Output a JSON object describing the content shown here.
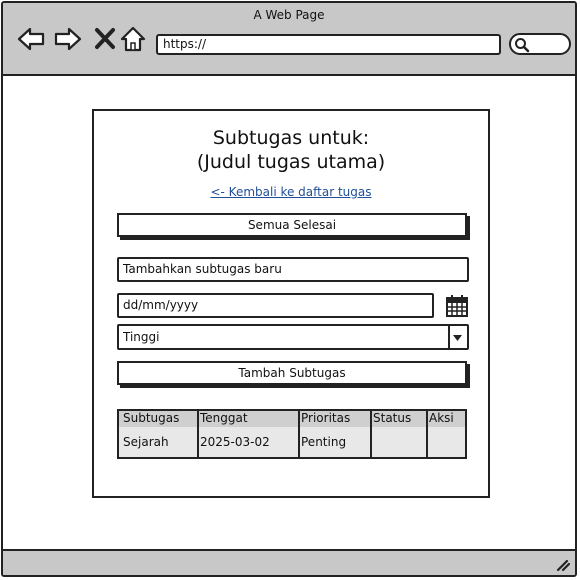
{
  "window": {
    "title": "A Web Page",
    "url": "https://"
  },
  "icons": {
    "back": "arrow-left-icon",
    "forward": "arrow-right-icon",
    "close": "close-icon",
    "home": "home-icon",
    "search": "search-icon",
    "calendar": "calendar-icon",
    "dropdown": "chevron-down-icon",
    "resize": "resize-grip-icon"
  },
  "page": {
    "title_line1": "Subtugas untuk:",
    "title_line2": "(Judul tugas utama)",
    "back_link": "<- Kembali ke daftar tugas",
    "all_done_button": "Semua Selesai",
    "new_subtask_placeholder": "Tambahkan subtugas baru",
    "date_placeholder": "dd/mm/yyyy",
    "priority_selected": "Tinggi",
    "add_button": "Tambah Subtugas"
  },
  "table": {
    "headers": [
      "Subtugas",
      "Tenggat",
      "Prioritas",
      "Status",
      "Aksi"
    ],
    "rows": [
      {
        "subtask": "Sejarah",
        "deadline": "2025-03-02",
        "priority": "Penting",
        "status": "",
        "action": ""
      }
    ]
  }
}
